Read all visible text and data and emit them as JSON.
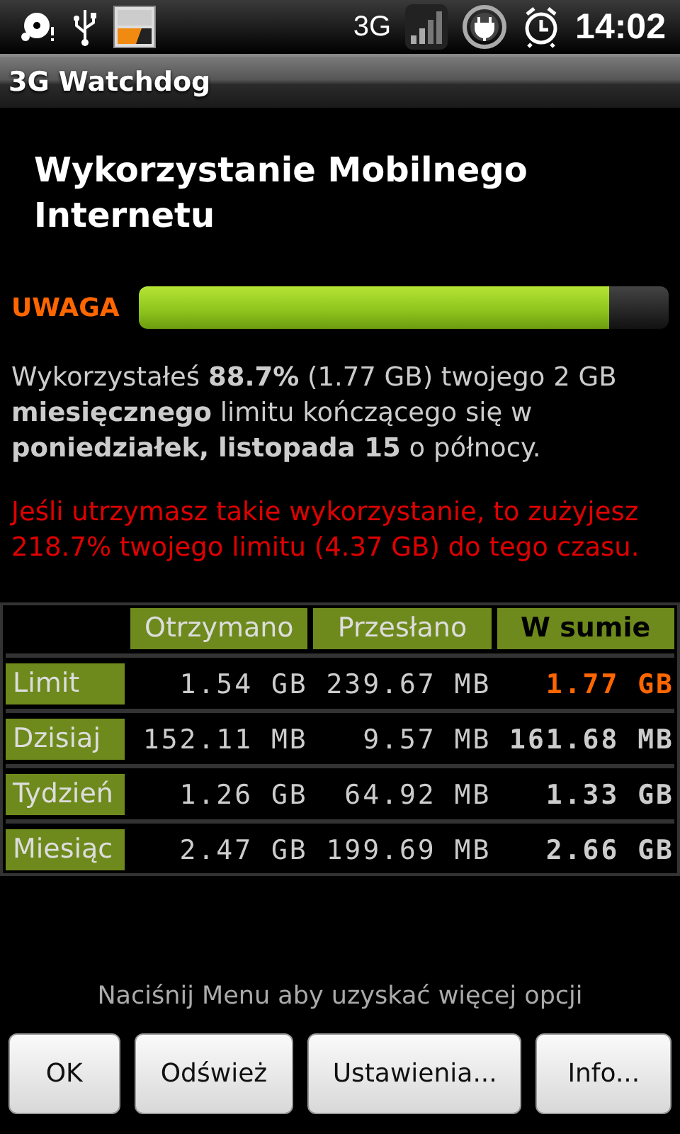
{
  "status_bar": {
    "network": "3G",
    "time": "14:02"
  },
  "window": {
    "title": "3G Watchdog"
  },
  "heading": "Wykorzystanie Mobilnego Internetu",
  "usage": {
    "label": "UWAGA",
    "level": 0.887
  },
  "summary": "Wykorzystałeś **88.7%** (1.77 GB) twojego 2 GB **miesięcznego** limitu kończącego się w **poniedziałek, listopada 15** o północy.",
  "forecast": "Jeśli utrzymasz takie wykorzystanie, to zużyjesz 218.7% twojego limitu (4.37 GB) do tego czasu.",
  "table": {
    "columns": [
      "Otrzymano",
      "Przesłano",
      "W sumie"
    ],
    "rows": [
      {
        "label": "Limit",
        "received": "1.54 GB",
        "sent": "239.67 MB",
        "total": "1.77 GB",
        "warning": true
      },
      {
        "label": "Dzisiaj",
        "received": "152.11 MB",
        "sent": "9.57 MB",
        "total": "161.68 MB",
        "warning": false
      },
      {
        "label": "Tydzień",
        "received": "1.26 GB",
        "sent": "64.92 MB",
        "total": "1.33 GB",
        "warning": false
      },
      {
        "label": "Miesiąc",
        "received": "2.47 GB",
        "sent": "199.69 MB",
        "total": "2.66 GB",
        "warning": false
      }
    ]
  },
  "hint": "Naciśnij Menu aby uzyskać więcej opcji",
  "buttons": [
    "OK",
    "Odśwież",
    "Ustawienia...",
    "Info..."
  ]
}
